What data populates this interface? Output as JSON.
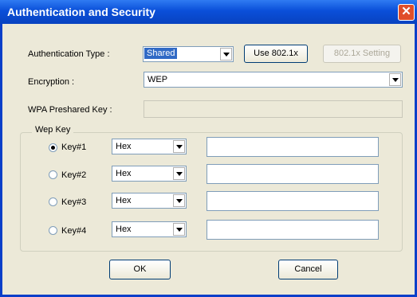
{
  "window": {
    "title": "Authentication and Security",
    "close_glyph": "✕"
  },
  "auth": {
    "label": "Authentication Type :",
    "value": "Shared",
    "use8021x_label": "Use 802.1x",
    "setting_label": "802.1x Setting"
  },
  "encryption": {
    "label": "Encryption :",
    "value": "WEP"
  },
  "wpa": {
    "label": "WPA Preshared Key :",
    "value": ""
  },
  "wep": {
    "title": "Wep Key",
    "keys": [
      {
        "label": "Key#1",
        "selected": true,
        "format": "Hex",
        "value": ""
      },
      {
        "label": "Key#2",
        "selected": false,
        "format": "Hex",
        "value": ""
      },
      {
        "label": "Key#3",
        "selected": false,
        "format": "Hex",
        "value": ""
      },
      {
        "label": "Key#4",
        "selected": false,
        "format": "Hex",
        "value": ""
      }
    ]
  },
  "buttons": {
    "ok": "OK",
    "cancel": "Cancel"
  },
  "colors": {
    "titlebar": "#0a4fd9",
    "close": "#e04e2a",
    "selection": "#316ac5",
    "dialog_bg": "#ece9d8"
  }
}
